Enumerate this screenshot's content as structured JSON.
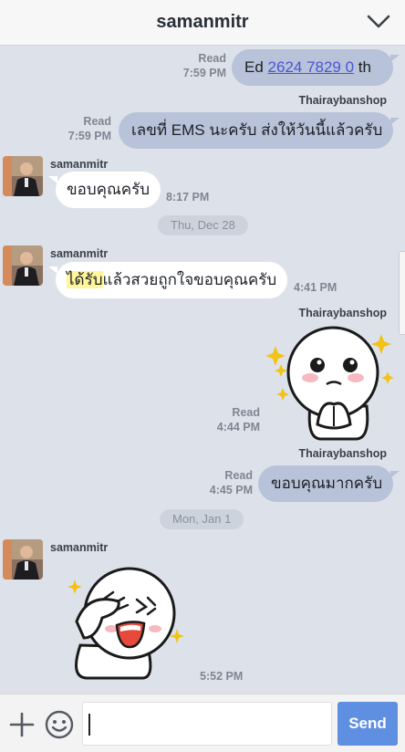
{
  "header": {
    "title": "samanmitr",
    "collapse_icon": "chevron-down-icon"
  },
  "messages": {
    "m1": {
      "status": "Read",
      "time": "7:59 PM",
      "text_prefix": "Ed ",
      "link": "2624 7829 0",
      "text_suffix": " th"
    },
    "m2": {
      "sender": "Thairaybanshop",
      "status": "Read",
      "time": "7:59 PM",
      "text": "เลขที่ EMS นะครับ ส่งให้วันนี้แล้วครับ"
    },
    "m3": {
      "sender": "samanmitr",
      "text": "ขอบคุณครับ",
      "time": "8:17 PM"
    },
    "date1": "Thu, Dec 28",
    "m4": {
      "sender": "samanmitr",
      "text_highlight": "ได้รับ",
      "text_rest": "แล้วสวยถูกใจขอบคุณครับ",
      "time": "4:41 PM"
    },
    "m5": {
      "sender": "Thairaybanshop",
      "status": "Read",
      "time": "4:44 PM",
      "sticker": "praying-bear-sticker"
    },
    "m6": {
      "sender": "Thairaybanshop",
      "status": "Read",
      "time": "4:45 PM",
      "text": "ขอบคุณมากครับ"
    },
    "date2": "Mon, Jan 1",
    "m7": {
      "sender": "samanmitr",
      "time": "5:52 PM",
      "sticker": "salute-sticker"
    }
  },
  "composer": {
    "send_label": "Send",
    "add_icon": "plus-icon",
    "emoji_icon": "smiley-icon"
  },
  "colors": {
    "outgoing": "#b8c2d8",
    "incoming": "#ffffff",
    "background": "#dde2ea",
    "send": "#5f8fe0"
  }
}
